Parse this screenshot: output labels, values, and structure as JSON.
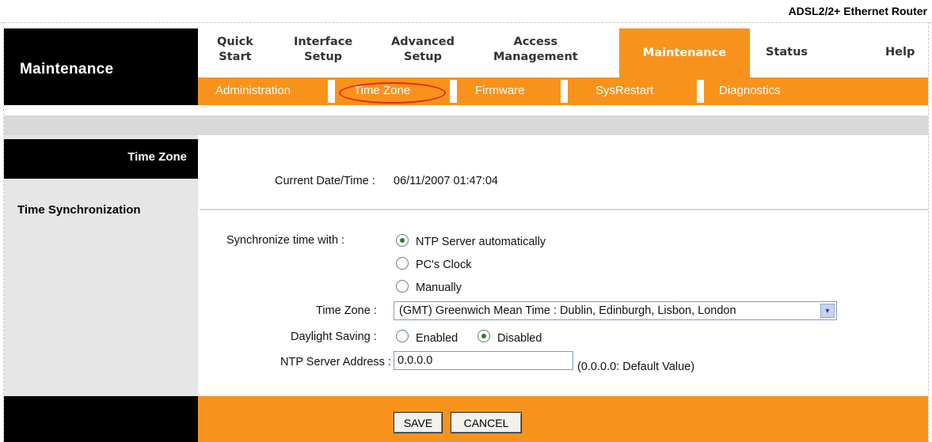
{
  "product_name": "ADSL2/2+ Ethernet Router",
  "logo_title": "Maintenance",
  "main_nav": [
    {
      "label_line1": "Quick",
      "label_line2": "Start"
    },
    {
      "label_line1": "Interface",
      "label_line2": "Setup"
    },
    {
      "label_line1": "Advanced",
      "label_line2": "Setup"
    },
    {
      "label_line1": "Access",
      "label_line2": "Management"
    },
    {
      "label": "Maintenance",
      "active": true
    },
    {
      "label": "Status"
    },
    {
      "label": "Help"
    }
  ],
  "sub_nav": [
    "Administration",
    "Time Zone",
    "Firmware",
    "SysRestart",
    "Diagnostics"
  ],
  "active_sub": "Time Zone",
  "sections": {
    "time_zone": "Time Zone",
    "time_sync": "Time Synchronization"
  },
  "form": {
    "current_datetime_label": "Current Date/Time :",
    "current_datetime_value": "06/11/2007 01:47:04",
    "sync_label": "Synchronize time with :",
    "sync_options": [
      "NTP Server automatically",
      "PC's Clock",
      "Manually"
    ],
    "sync_selected": "NTP Server automatically",
    "timezone_label": "Time Zone :",
    "timezone_value": "(GMT) Greenwich Mean Time : Dublin, Edinburgh, Lisbon, London",
    "daylight_label": "Daylight Saving :",
    "daylight_options": [
      "Enabled",
      "Disabled"
    ],
    "daylight_selected": "Disabled",
    "ntp_label": "NTP Server Address :",
    "ntp_value": "0.0.0.0",
    "ntp_hint": "(0.0.0.0: Default Value)"
  },
  "buttons": {
    "save": "SAVE",
    "cancel": "CANCEL"
  },
  "colors": {
    "accent": "#f7931d",
    "header_black": "#000000",
    "panel_gray": "#e6e6e6"
  }
}
